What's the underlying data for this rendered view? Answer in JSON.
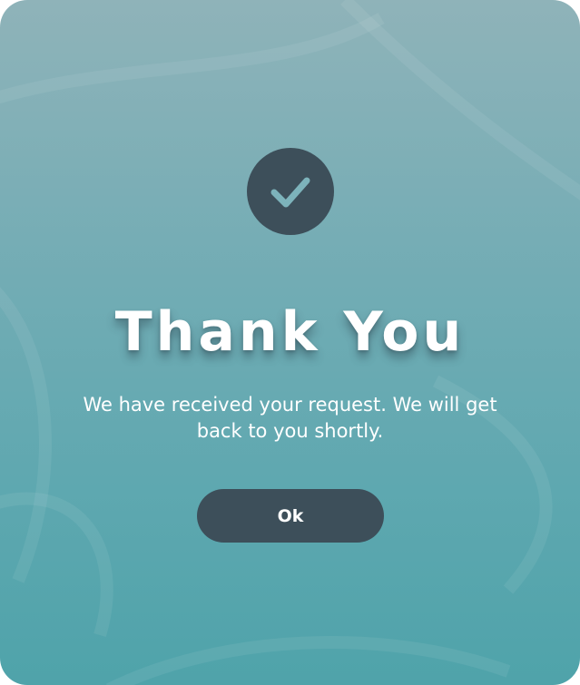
{
  "dialog": {
    "title": "Thank You",
    "message": "We have received your request. We will get back to you shortly.",
    "ok_label": "Ok",
    "icon": "check-icon"
  },
  "colors": {
    "background_top": "#8fb3b9",
    "background_bottom": "#4fa3aa",
    "accent_dark": "#3d4f5a",
    "check_color": "#7db3bb",
    "text": "#ffffff"
  }
}
